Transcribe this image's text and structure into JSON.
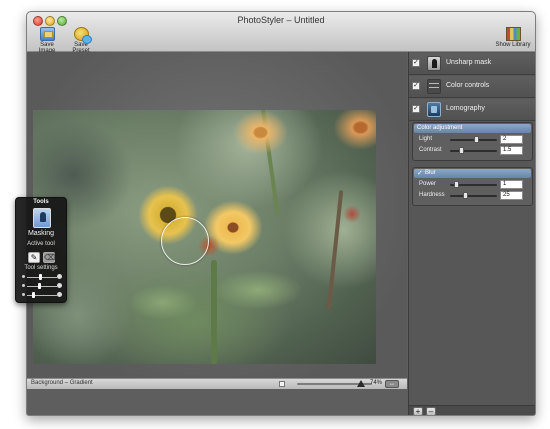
{
  "window": {
    "title": "PhotoStyler – Untitled"
  },
  "toolbar": {
    "save_image": "Save Image",
    "save_preset": "Save Preset",
    "show_library": "Show Library"
  },
  "filters": [
    {
      "label": "Unsharp mask",
      "checked": true,
      "icon": "unsharp-icon"
    },
    {
      "label": "Color controls",
      "checked": true,
      "icon": "color-controls-icon"
    },
    {
      "label": "Lomography",
      "checked": true,
      "icon": "lomography-icon"
    }
  ],
  "color_adjustment": {
    "title": "Color adjustment",
    "light": {
      "label": "Light",
      "value": "2",
      "level": 0.55
    },
    "contrast": {
      "label": "Contrast",
      "value": "1.5",
      "level": 0.2
    }
  },
  "blur": {
    "title": "Blur",
    "checked": true,
    "power": {
      "label": "Power",
      "value": "1",
      "level": 0.1
    },
    "hardness": {
      "label": "Hardness",
      "value": "25",
      "level": 0.3
    }
  },
  "tools": {
    "title": "Tools",
    "current": "Masking",
    "active_tool_label": "Active tool",
    "settings_label": "Tool settings",
    "settings_levels": [
      0.45,
      0.4,
      0.2
    ]
  },
  "status": {
    "layer": "Background – Gradient",
    "zoom": "74%",
    "zoom_level": 0.85
  },
  "panel_footer": {
    "add": "+",
    "remove": "–"
  },
  "colors": {
    "panel_bg": "#575757",
    "group_header": "#7b97b9",
    "palette_bg": "#161616"
  }
}
